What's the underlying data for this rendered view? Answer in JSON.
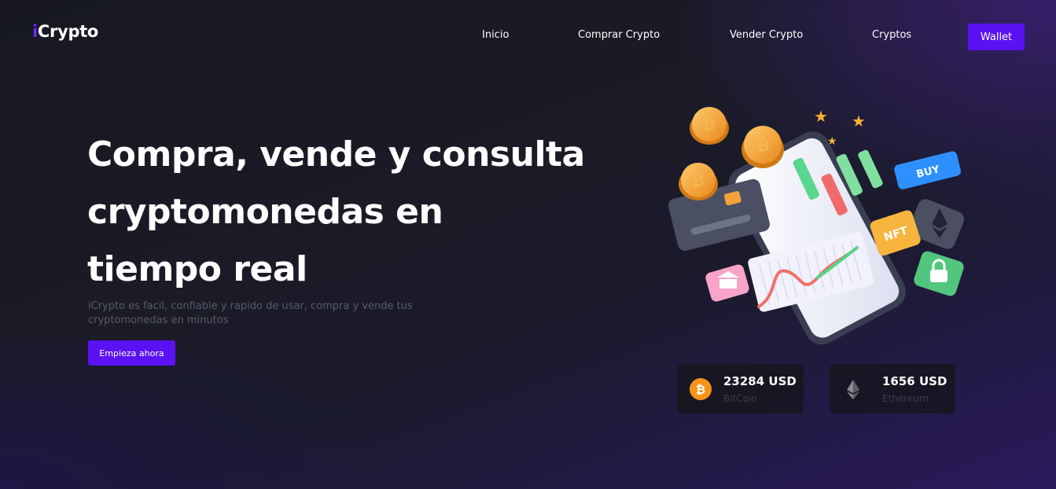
{
  "header": {
    "logo_accent": "i",
    "logo_text": "Crypto",
    "nav": [
      {
        "label": "Inicio"
      },
      {
        "label": "Comprar Crypto"
      },
      {
        "label": "Vender Crypto"
      },
      {
        "label": "Cryptos"
      }
    ],
    "wallet_label": "Wallet"
  },
  "hero": {
    "title_line1": "Compra, vende y consulta",
    "title_line2": "cryptomonedas en",
    "title_line3": "tiempo real",
    "subtitle": "iCrypto es facil, confiable y rapido de usar, compra y vende tus cryptomonedas en minutos",
    "cta_label": "Empieza ahora"
  },
  "illustration": {
    "buy_label": "BUY",
    "nft_label": "NFT"
  },
  "prices": [
    {
      "price": "23284 USD",
      "name": "BitCoin",
      "icon": "bitcoin-icon"
    },
    {
      "price": "1656 USD",
      "name": "Ethereum",
      "icon": "ethereum-icon"
    }
  ],
  "colors": {
    "accent": "#5a12f3",
    "logo_accent": "#6b2bff",
    "bitcoin": "#f7931a",
    "muted_text": "#575a68"
  }
}
